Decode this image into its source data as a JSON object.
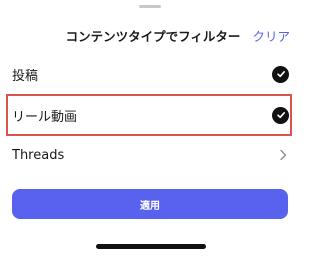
{
  "header": {
    "title": "コンテンツタイプでフィルター",
    "clear_label": "クリア"
  },
  "options": [
    {
      "label": "投稿",
      "selected": true,
      "indicator": "check-circle-icon"
    },
    {
      "label": "リール動画",
      "selected": true,
      "indicator": "check-circle-icon",
      "highlighted": true
    },
    {
      "label": "Threads",
      "selected": false,
      "indicator": "chevron-right-icon"
    }
  ],
  "apply_button": {
    "label": "適用"
  },
  "colors": {
    "accent": "#5862ee",
    "highlight_border": "#d9534f",
    "check_fill": "#111111"
  }
}
